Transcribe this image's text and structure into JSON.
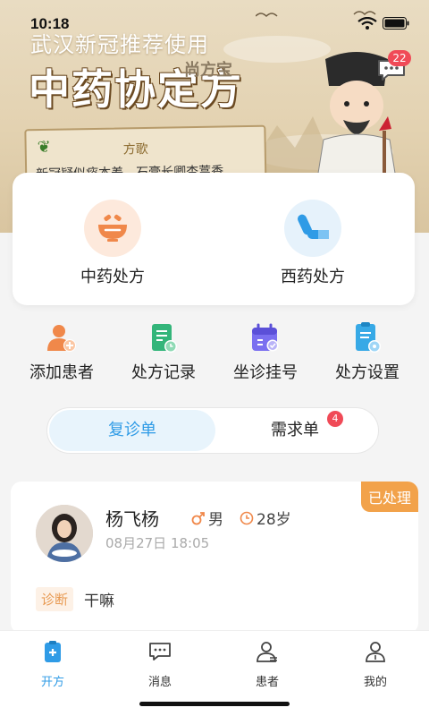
{
  "status_bar": {
    "time": "10:18"
  },
  "banner": {
    "subtitle": "武汉新冠推荐使用",
    "title": "中药协定方",
    "brand": "尚方宝",
    "paper_title": "方歌",
    "paper_text": "新冠疑似痰本差，石膏长卿杏蒿香",
    "messages_badge": "22"
  },
  "prescriptions": [
    {
      "label": "中药处方",
      "icon": "herbal-bowl-icon"
    },
    {
      "label": "西药处方",
      "icon": "pill-capsule-icon"
    }
  ],
  "quick_actions": [
    {
      "label": "添加患者",
      "icon": "add-patient-icon"
    },
    {
      "label": "处方记录",
      "icon": "prescription-record-icon"
    },
    {
      "label": "坐诊挂号",
      "icon": "calendar-appointment-icon"
    },
    {
      "label": "处方设置",
      "icon": "prescription-settings-icon"
    }
  ],
  "tabs": {
    "follow_up": "复诊单",
    "requests": "需求单",
    "requests_badge": "4"
  },
  "record": {
    "status": "已处理",
    "name": "杨飞杨",
    "gender": "男",
    "age": "28岁",
    "date": "08月27日 18:05",
    "diagnosis_label": "诊断",
    "diagnosis": "干嘛"
  },
  "nav": [
    {
      "label": "开方",
      "active": true
    },
    {
      "label": "消息"
    },
    {
      "label": "患者"
    },
    {
      "label": "我的"
    }
  ],
  "colors": {
    "accent": "#2f9be6",
    "badge": "#f04a57",
    "status": "#f2a24a",
    "herbal": "#f0884a"
  }
}
